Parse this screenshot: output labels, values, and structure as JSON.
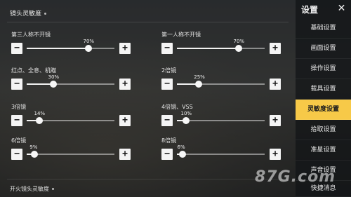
{
  "section_title": "镜头灵敏度",
  "settings": [
    {
      "label": "第三人称不开镜",
      "value": "70%",
      "level": 0.7
    },
    {
      "label": "第一人称不开镜",
      "value": "70%",
      "level": 0.7
    },
    {
      "label": "红点、全息、机瞄",
      "value": "30%",
      "level": 0.3
    },
    {
      "label": "2倍镜",
      "value": "25%",
      "level": 0.25
    },
    {
      "label": "3倍镜",
      "value": "14%",
      "level": 0.14
    },
    {
      "label": "4倍镜、VSS",
      "value": "10%",
      "level": 0.1
    },
    {
      "label": "6倍镜",
      "value": "9%",
      "level": 0.09
    },
    {
      "label": "8倍镜",
      "value": "6%",
      "level": 0.06
    }
  ],
  "buttons": {
    "minus": "−",
    "plus": "+"
  },
  "footer_title": "开火镜头灵敏度",
  "sidebar": {
    "title": "设置",
    "close": "✕",
    "items": [
      {
        "label": "基础设置",
        "active": false
      },
      {
        "label": "画面设置",
        "active": false
      },
      {
        "label": "操作设置",
        "active": false
      },
      {
        "label": "载具设置",
        "active": false
      },
      {
        "label": "灵敏度设置",
        "active": true
      },
      {
        "label": "拾取设置",
        "active": false
      },
      {
        "label": "准星设置",
        "active": false
      },
      {
        "label": "声音设置",
        "active": false
      },
      {
        "label": "快捷消息",
        "active": false
      }
    ]
  },
  "watermark": "87G.com",
  "colors": {
    "accent": "#f7c948"
  }
}
